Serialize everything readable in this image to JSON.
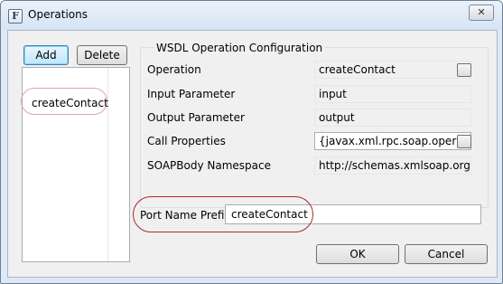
{
  "window": {
    "title": "Operations",
    "app_icon_glyph": "F",
    "close_glyph": "✕"
  },
  "toolbar": {
    "add_label": "Add",
    "delete_label": "Delete"
  },
  "operations": {
    "items": [
      "createContact"
    ]
  },
  "config": {
    "group_title": "WSDL Operation Configuration",
    "operation_label": "Operation",
    "operation_value": "createContact",
    "input_label": "Input Parameter",
    "input_value": "input",
    "output_label": "Output Parameter",
    "output_value": "output",
    "call_props_label": "Call Properties",
    "call_props_value": "{javax.xml.rpc.soap.operation",
    "soapbody_label": "SOAPBody Namespace",
    "soapbody_value": "http://schemas.xmlsoap.org/ws"
  },
  "port": {
    "label": "Port Name Prefix",
    "value": "createContact"
  },
  "actions": {
    "ok_label": "OK",
    "cancel_label": "Cancel"
  },
  "colors": {
    "highlight_strong": "#b0262c",
    "highlight_soft": "#e3a3a6",
    "default_button_border": "#3c7fb1"
  }
}
